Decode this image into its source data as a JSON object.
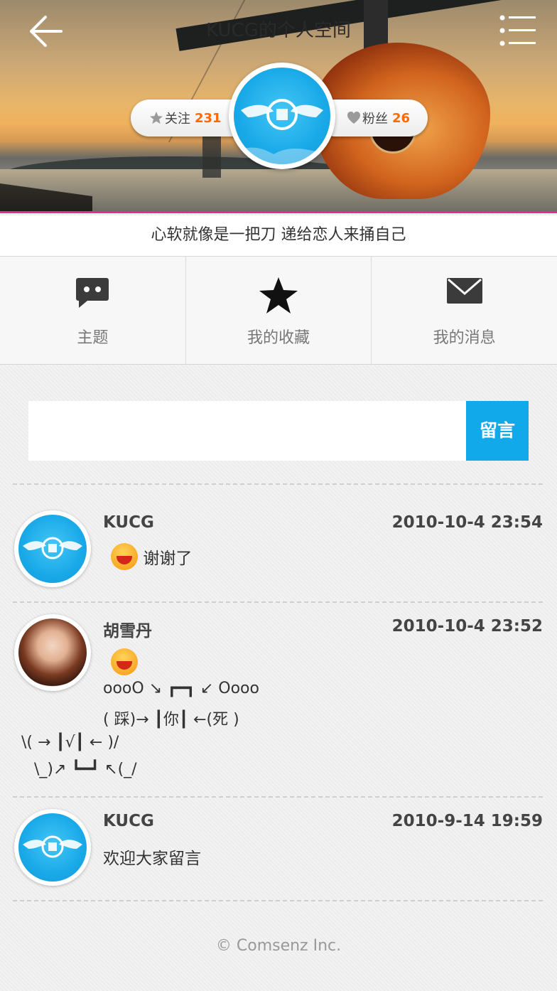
{
  "header": {
    "title": "KUCG的个人空间",
    "follow_label": "关注",
    "follow_count": "231",
    "fans_label": "粉丝",
    "fans_count": "26"
  },
  "signature": "心软就像是一把刀 递给恋人来捅自己",
  "tabs": [
    {
      "label": "主题",
      "icon": "chat-bubble-icon"
    },
    {
      "label": "我的收藏",
      "icon": "star-icon"
    },
    {
      "label": "我的消息",
      "icon": "envelope-icon"
    }
  ],
  "message_box": {
    "placeholder": "",
    "button_label": "留言"
  },
  "comments": [
    {
      "author": "KUCG",
      "time": "2010-10-4 23:54",
      "text": "谢谢了",
      "has_emoji": true
    },
    {
      "author": "胡雪丹",
      "time": "2010-10-4 23:52",
      "has_emoji": true,
      "lines": [
        "oooO ↘ ┏━┓ ↙ Oooo",
        "( 踩)→ ┃你┃ ←(死 )",
        "\\( → ┃√┃ ← )/",
        "\\_)↗ ┗━┛ ↖(_/"
      ]
    },
    {
      "author": "KUCG",
      "time": "2010-9-14 19:59",
      "text": "欢迎大家留言",
      "has_emoji": false
    }
  ],
  "footer": "© Comsenz Inc.",
  "colors": {
    "accent_blue": "#12a9ea",
    "count_orange": "#ff6a00",
    "pink_line": "#e0318a"
  }
}
